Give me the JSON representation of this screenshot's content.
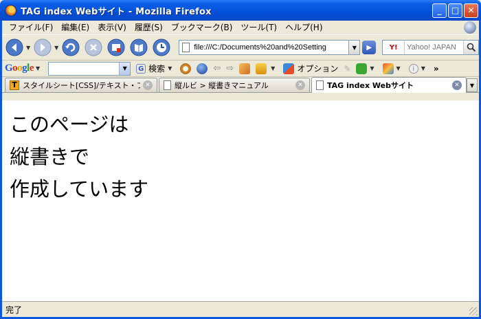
{
  "window": {
    "title": "TAG index Webサイト - Mozilla Firefox",
    "minimize": "_",
    "maximize": "□",
    "close": "✕"
  },
  "menu": {
    "items": [
      "ファイル(F)",
      "編集(E)",
      "表示(V)",
      "履歴(S)",
      "ブックマーク(B)",
      "ツール(T)",
      "ヘルプ(H)"
    ]
  },
  "nav": {
    "url": "file:///C:/Documents%20and%20Setting",
    "search_engine": "Y!",
    "search_placeholder": "Yahoo! JAPAN"
  },
  "google_toolbar": {
    "logo": "Google",
    "search_label": "検索",
    "options_label": "オプション",
    "more": "»"
  },
  "tabs": [
    {
      "label": "スタイルシート[CSS]/テキスト・フォ…",
      "icon": "T",
      "active": false
    },
    {
      "label": "縦ルビ > 縦書きマニュアル",
      "icon": "",
      "active": false
    },
    {
      "label": "TAG index Webサイト",
      "icon": "",
      "active": true
    }
  ],
  "content": {
    "lines": [
      "このページは",
      "縦書きで",
      "作成しています"
    ]
  },
  "status": {
    "text": "完了"
  },
  "colors": {
    "titlebar": "#0350d8",
    "chrome": "#ece9d8"
  }
}
